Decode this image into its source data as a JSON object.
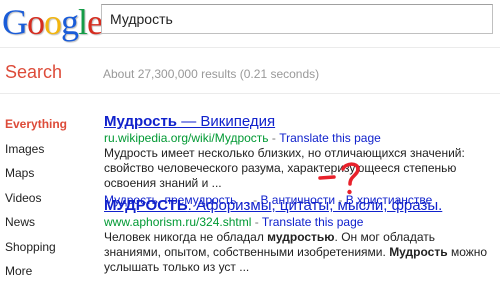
{
  "logo": {
    "letters": [
      "G",
      "o",
      "o",
      "g",
      "l",
      "e"
    ],
    "colors": [
      "#1a5cd8",
      "#d62d20",
      "#f2b50f",
      "#1a5cd8",
      "#159c47",
      "#d62d20"
    ]
  },
  "search": {
    "query": "Мудрость"
  },
  "header": {
    "search_label": "Search",
    "stats": "About 27,300,000 results (0.21 seconds)"
  },
  "sidebar": {
    "items": [
      {
        "label": "Everything",
        "active": true
      },
      {
        "label": "Images"
      },
      {
        "label": "Maps"
      },
      {
        "label": "Videos"
      },
      {
        "label": "News"
      },
      {
        "label": "Shopping"
      },
      {
        "label": "More"
      }
    ]
  },
  "results": [
    {
      "title_bold": "Мудрость",
      "title_rest": " — Википедия",
      "url": "ru.wikipedia.org/wiki/Мудрость",
      "separator": " - ",
      "translate": "Translate this page",
      "snippet_parts": [
        "Мудрость",
        " имеет несколько близких, но отличающихся значений: свойство человеческого разума, характеризующееся степенью освоения знаний и ..."
      ],
      "sitelinks": [
        "Мудрость, премудрость ...",
        "В античности",
        "В христианстве"
      ],
      "sitelink_separator": " - "
    },
    {
      "title_bold": "МУДРОСТЬ",
      "title_rest": ". Афоризмы, цитаты, мысли, фразы.",
      "url": "www.aphorism.ru/324.shtml",
      "separator": " - ",
      "translate": "Translate this page",
      "snippet_parts": [
        "Человек никогда не обладал ",
        "мудростью",
        ". Он мог обладать знаниями, опытом, собственными изобретениями. ",
        "Мудрость",
        " можно услышать только из уст ..."
      ]
    }
  ],
  "annotation": {
    "color": "#e8212b",
    "dash": "–",
    "mark": "?"
  }
}
